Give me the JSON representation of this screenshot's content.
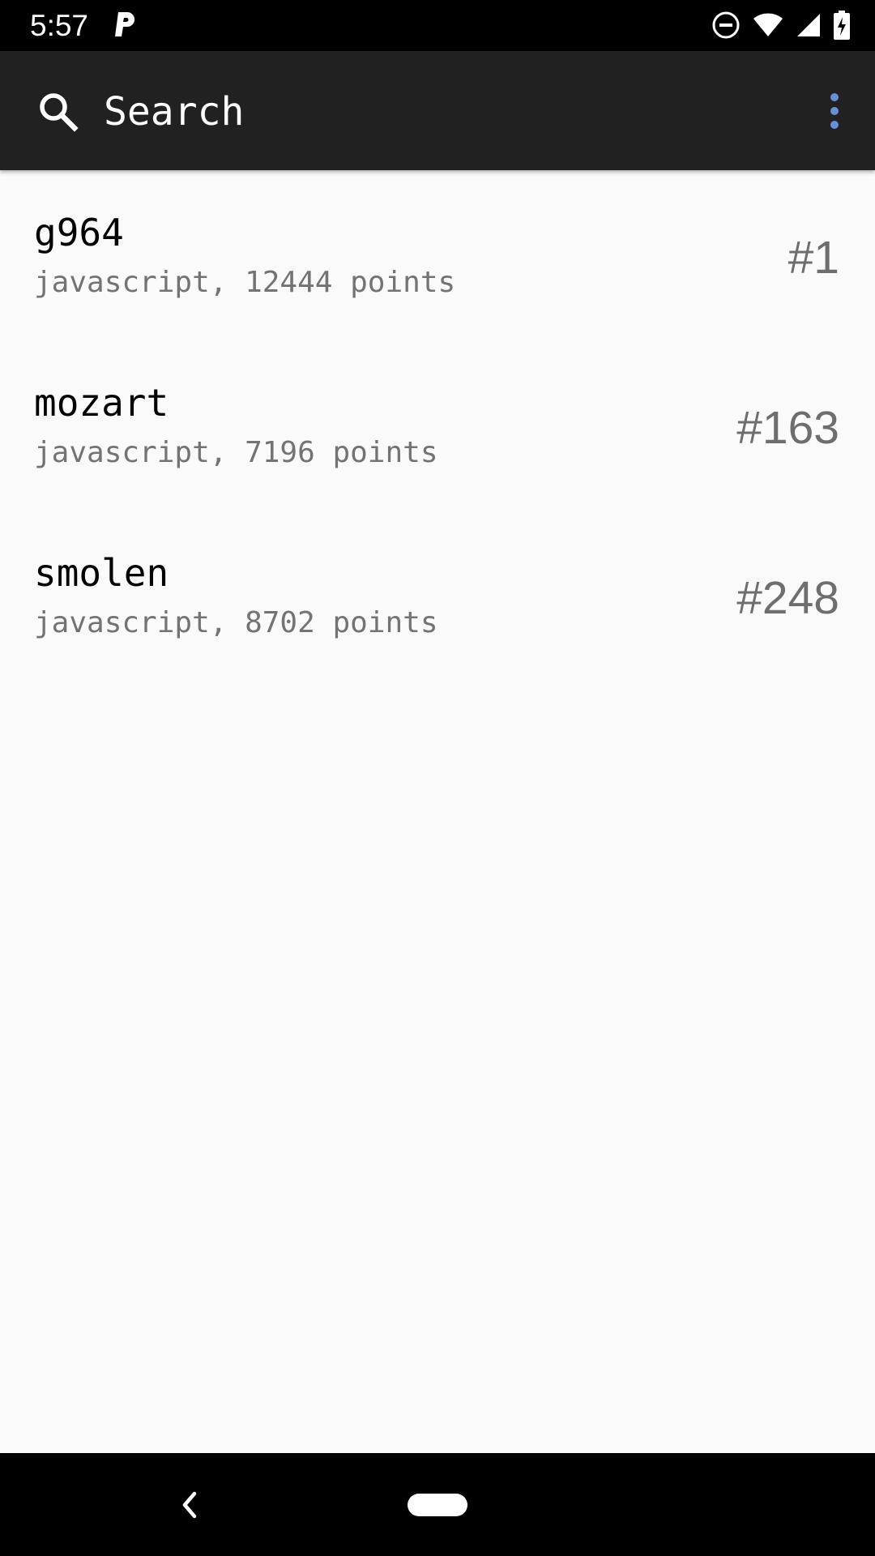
{
  "status_bar": {
    "time": "5:57",
    "icons": [
      "parking-icon",
      "do-not-disturb-icon",
      "wifi-icon",
      "signal-icon",
      "battery-charging-icon"
    ]
  },
  "toolbar": {
    "search_label": "Search",
    "icons": [
      "search-icon",
      "more-vert-icon"
    ],
    "accent_color": "#6b8fd6",
    "background_color": "#212121"
  },
  "results": [
    {
      "name": "g964",
      "meta": "javascript, 12444 points",
      "rank": "#1"
    },
    {
      "name": "mozart",
      "meta": "javascript, 7196 points",
      "rank": "#163"
    },
    {
      "name": "smolen",
      "meta": "javascript, 8702 points",
      "rank": "#248"
    }
  ],
  "nav_bar": {
    "icons": [
      "back-icon",
      "home-pill-icon"
    ]
  }
}
